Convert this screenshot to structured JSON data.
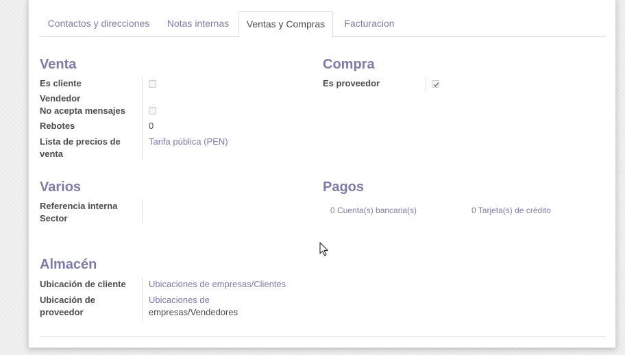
{
  "tabs": [
    {
      "label": "Contactos y direcciones"
    },
    {
      "label": "Notas internas"
    },
    {
      "label": "Ventas y Compras"
    },
    {
      "label": "Facturacion"
    }
  ],
  "sales": {
    "title": "Venta",
    "is_customer_label": "Es cliente",
    "salesperson_label": "Vendedor",
    "no_messages_label": "No acepta mensajes",
    "bounces_label": "Rebotes",
    "bounces_value": "0",
    "pricelist_label": "Lista de precios de venta",
    "pricelist_value": "Tarifa pública (PEN)"
  },
  "purchase": {
    "title": "Compra",
    "is_vendor_label": "Es proveedor",
    "is_vendor_checked": true
  },
  "misc": {
    "title": "Varios",
    "internal_ref_label": "Referencia interna",
    "sector_label": "Sector"
  },
  "payments": {
    "title": "Pagos",
    "bank_accounts": "0 Cuenta(s) bancaria(s)",
    "credit_cards": "0 Tarjeta(s) de crédito"
  },
  "warehouse": {
    "title": "Almacén",
    "customer_location_label": "Ubicación de cliente",
    "customer_location_value": "Ubicaciones de empresas/Clientes",
    "vendor_location_label": "Ubicación de proveedor",
    "vendor_location_link": "Ubicaciones de",
    "vendor_location_rest": "empresas/Vendedores"
  },
  "colors": {
    "accent": "#7c7bad",
    "text": "#4c4c4c"
  }
}
